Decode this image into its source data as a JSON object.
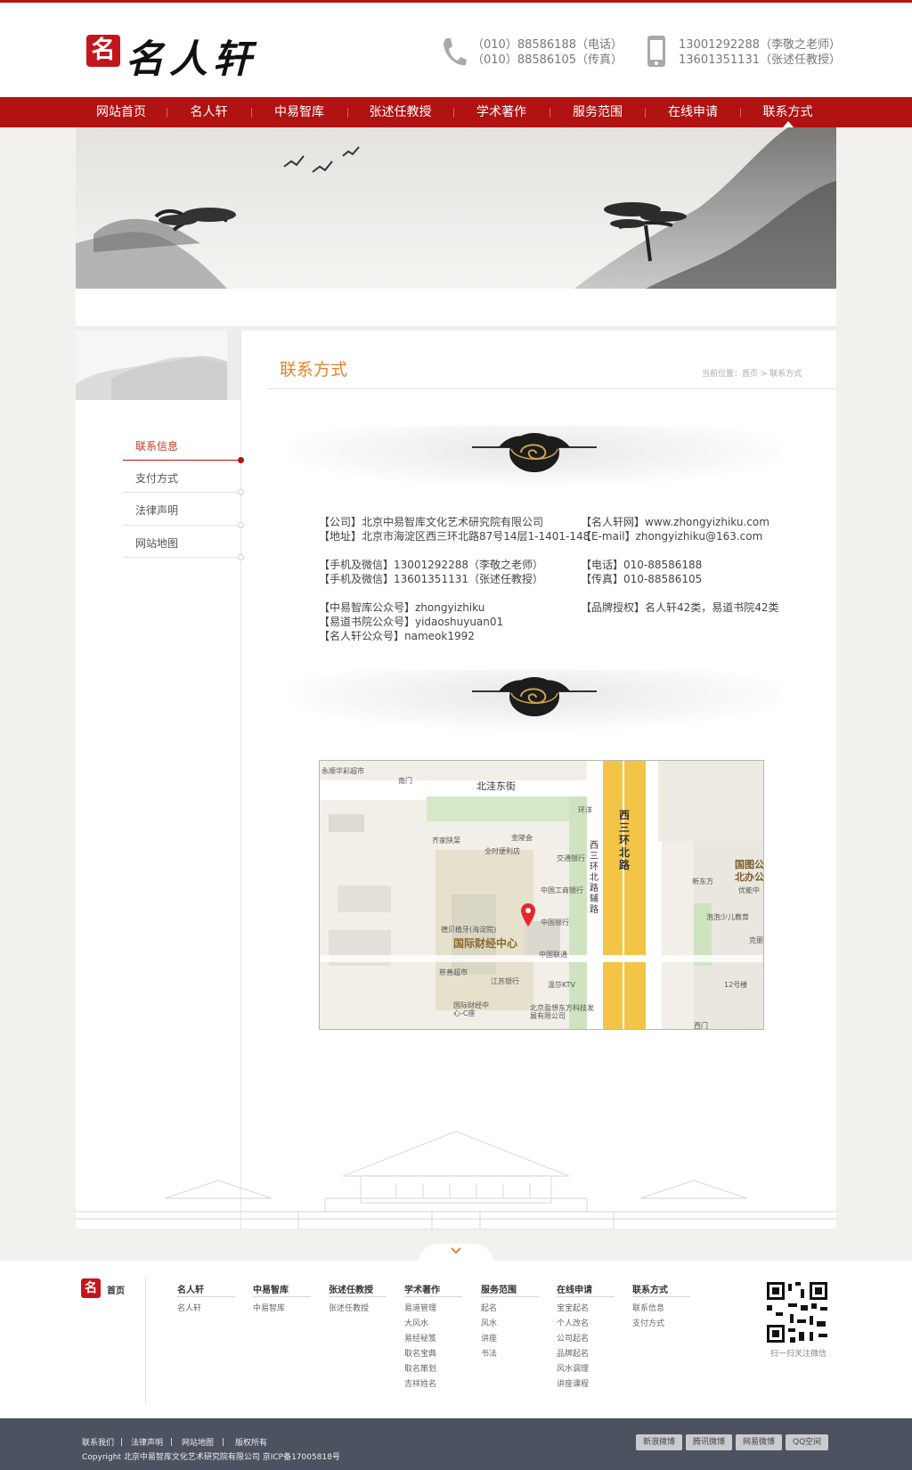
{
  "header": {
    "logo_text": "名人轩",
    "logo_mark": "名",
    "phone": {
      "tel_line": "（010）88586188（电话）",
      "fax_line": "（010）88586105（传真）"
    },
    "mobile": {
      "line1": "13001292288（李敬之老师）",
      "line2": "13601351131（张述任教授）"
    }
  },
  "nav": {
    "items": [
      "网站首页",
      "名人轩",
      "中易智库",
      "张述任教授",
      "学术著作",
      "服务范围",
      "在线申请",
      "联系方式"
    ],
    "active": "联系方式"
  },
  "sidebar": {
    "items": [
      "联系信息",
      "支付方式",
      "法律声明",
      "网站地图"
    ],
    "active": "联系信息"
  },
  "page": {
    "title": "联系方式",
    "breadcrumb": "当前位置：首页 > 联系方式"
  },
  "contact": {
    "left": {
      "company": "【公司】北京中易智库文化艺术研究院有限公司",
      "address": "【地址】北京市海淀区西三环北路87号14层1-1401-148",
      "mobile1": "【手机及微信】13001292288（李敬之老师）",
      "mobile2": "【手机及微信】13601351131（张述任教授）",
      "wx1": "【中易智库公众号】zhongyizhiku",
      "wx2": "【易道书院公众号】yidaoshuyuan01",
      "wx3": "【名人轩公众号】nameok1992"
    },
    "right": {
      "site": "【名人轩网】www.zhongyizhiku.com",
      "email": "【E-mail】zhongyizhiku@163.com",
      "tel": "【电话】010-88586188",
      "fax": "【传真】010-88586105",
      "brand": "【品牌授权】名人轩42类，易道书院42类"
    }
  },
  "map": {
    "labels": {
      "yongshun": "永顺华彩超市",
      "nanmen": "南门",
      "beiwa": "北洼东街",
      "huanyang": "环洋",
      "qijia": "齐家陕菜",
      "jinlinghui": "金陵会",
      "quanshi": "全时便利店",
      "jiaotong": "交通银行",
      "gongshang": "中国工商银行",
      "zhongguo": "中国银行",
      "debei": "德贝植牙(海淀院)",
      "ifc": "国际财经中心",
      "cishan": "慈善超市",
      "liantong": "中国联通",
      "jiangsu": "江苏银行",
      "wenxun": "温莎KTV",
      "ifc_c": "国际财经中心-C座",
      "yingxiang": "北京盈想东方科技发展有限公司",
      "xisanhuan": "西三环北路",
      "fulu": "西三环北路辅路",
      "guotu": "国图公北办公",
      "xindongfang": "新东方",
      "youneng": "优能中",
      "paopao": "泡泡少儿教育",
      "ke": "克丽",
      "twelve": "12号楼",
      "ximen": "西门"
    }
  },
  "footer": {
    "home": "首页",
    "columns": [
      {
        "title": "名人轩",
        "links": [
          "名人轩"
        ]
      },
      {
        "title": "中易智库",
        "links": [
          "中易智库"
        ]
      },
      {
        "title": "张述任教授",
        "links": [
          "张述任教授"
        ]
      },
      {
        "title": "学术著作",
        "links": [
          "易道管理",
          "大风水",
          "易经秘笈",
          "取名宝典",
          "取名策划",
          "吉祥姓名"
        ]
      },
      {
        "title": "服务范围",
        "links": [
          "起名",
          "风水",
          "讲座",
          "书法"
        ]
      },
      {
        "title": "在线申请",
        "links": [
          "宝宝起名",
          "个人改名",
          "公司起名",
          "品牌起名",
          "风水调理",
          "讲座课程"
        ]
      },
      {
        "title": "联系方式",
        "links": [
          "联系信息",
          "支付方式"
        ]
      }
    ],
    "qr_caption": "扫一扫关注微信"
  },
  "bottom": {
    "links": [
      "联系我们",
      "法律声明",
      "网站地图",
      "版权所有"
    ],
    "copyright": "Copyright 北京中易智库文化艺术研究院有限公司 京ICP备17005818号",
    "share": [
      "新浪微博",
      "腾讯微博",
      "网易微博",
      "QQ空间"
    ]
  },
  "colors": {
    "nav_red": "#b11212",
    "title_orange": "#e6842c",
    "bottom_bar": "#4d5260"
  }
}
